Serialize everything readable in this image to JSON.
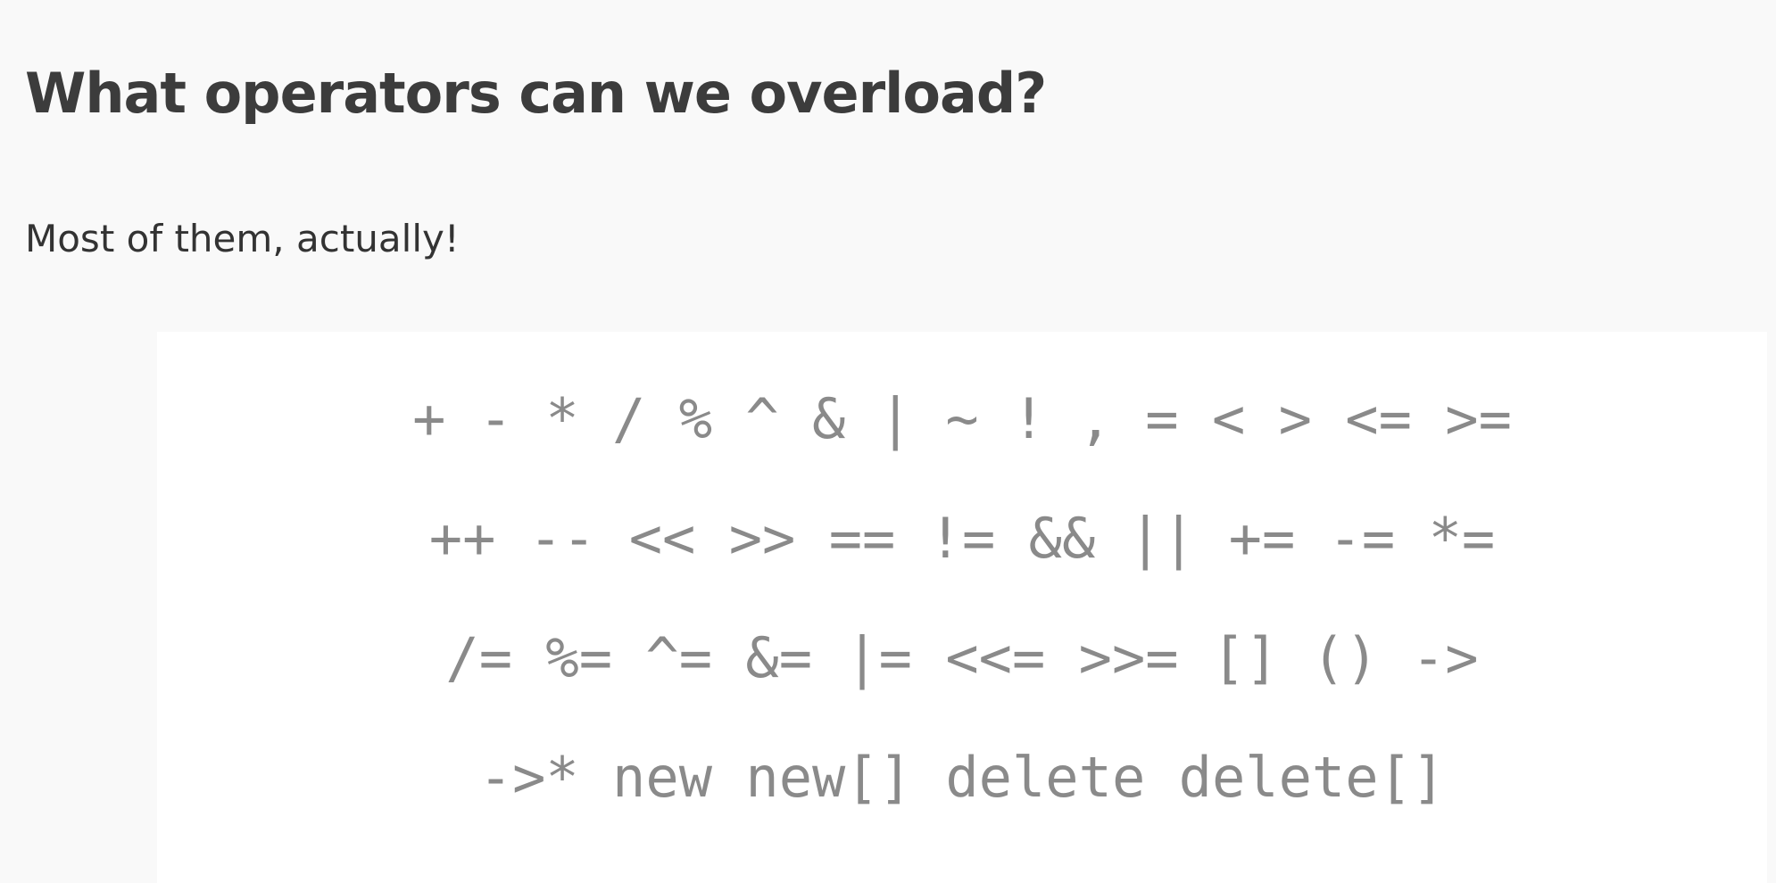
{
  "slide": {
    "title": "What operators can we overload?",
    "subtitle": "Most of them, actually!",
    "operator_lines": [
      "+ - * / % ^ & | ~ ! , = < > <= >=",
      "++ -- << >> == != && || += -= *=",
      "/= %= ^= &= |= <<= >>= [] () ->",
      "->* new new[] delete delete[]"
    ]
  },
  "colors": {
    "background": "#f9f9f9",
    "code_background": "#ffffff",
    "title_text": "#3c3c3c",
    "body_text": "#333333",
    "code_text": "#8a8a8a"
  }
}
